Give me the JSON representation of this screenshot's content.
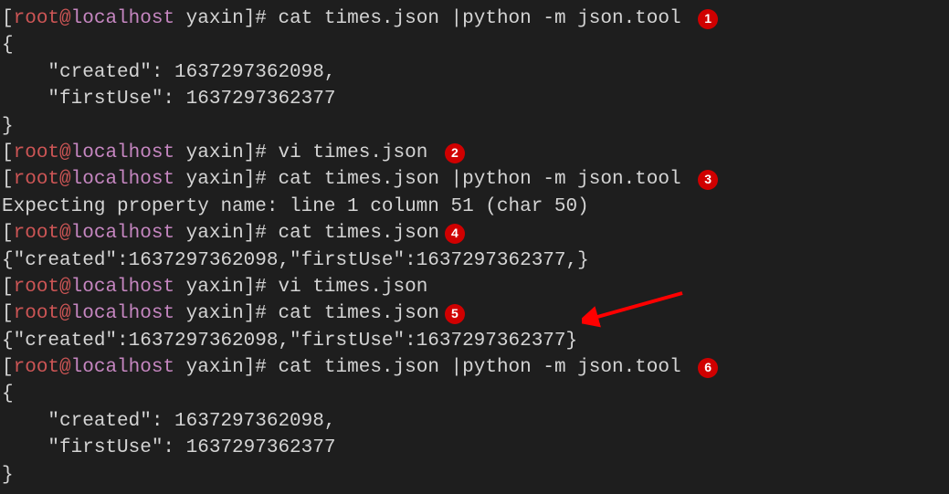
{
  "prompt": {
    "user": "root",
    "at": "@",
    "host": "localhost",
    "dir": "yaxin",
    "hash": "#"
  },
  "commands": {
    "cmd1": "cat times.json |python -m json.tool",
    "cmd2": "vi times.json",
    "cmd3": "cat times.json |python -m json.tool",
    "cmd4": "cat times.json",
    "cmd5": "vi times.json",
    "cmd6": "cat times.json",
    "cmd7": "cat times.json |python -m json.tool"
  },
  "outputs": {
    "json_pretty_open": "{",
    "json_created": "    \"created\": 1637297362098,",
    "json_firstuse": "    \"firstUse\": 1637297362377",
    "json_pretty_close": "}",
    "error": "Expecting property name: line 1 column 51 (char 50)",
    "raw_bad": "{\"created\":1637297362098,\"firstUse\":1637297362377,}",
    "raw_good": "{\"created\":1637297362098,\"firstUse\":1637297362377}"
  },
  "badges": {
    "b1": "1",
    "b2": "2",
    "b3": "3",
    "b4": "4",
    "b5": "5",
    "b6": "6"
  }
}
